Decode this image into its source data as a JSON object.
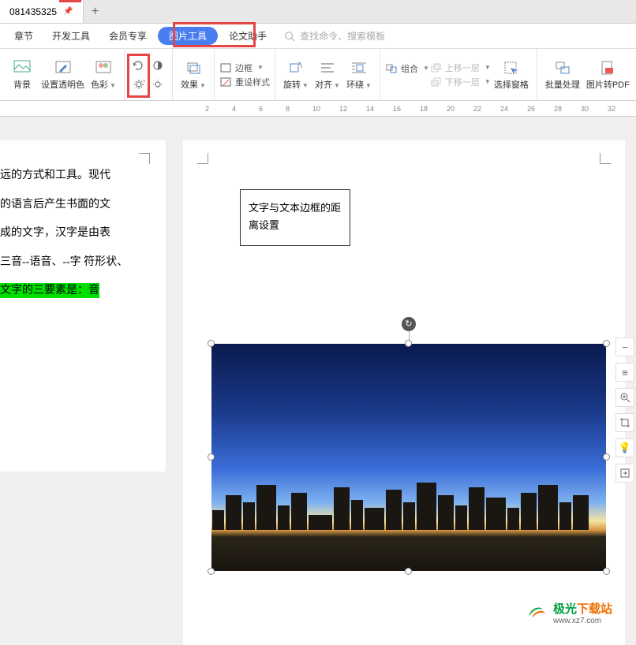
{
  "tab": {
    "title": "081435325",
    "add_tooltip": "+"
  },
  "menu": {
    "items": [
      "章节",
      "开发工具",
      "会员专享",
      "图片工具",
      "论文助手"
    ],
    "active_index": 3,
    "search_placeholder": "查找命令、搜索模板"
  },
  "ribbon": {
    "bg": "背景",
    "trans_color": "设置透明色",
    "color": "色彩",
    "brightness_inc": "增加亮度",
    "brightness_dec": "降低亮度",
    "effects": "效果",
    "border": "边框",
    "reset_style": "重设样式",
    "rotate": "旋转",
    "align": "对齐",
    "wrap": "环绕",
    "group": "组合",
    "layer_up": "上移一层",
    "layer_down": "下移一层",
    "select_pane": "选择窗格",
    "batch": "批量处理",
    "to_pdf": "图片转PDF"
  },
  "ruler": {
    "marks": [
      "2",
      "4",
      "6",
      "8",
      "10",
      "12",
      "14",
      "16",
      "18",
      "20",
      "22",
      "24",
      "26",
      "28",
      "30",
      "32"
    ]
  },
  "page_left": {
    "lines": [
      "远的方式和工具。现代",
      "的语言后产生书面的文",
      "成的文字，汉字是由表",
      "三音--语音、--字 符形状、",
      "文字的三要素是：音"
    ]
  },
  "textbox": {
    "content": "文字与文本边框的距离设置"
  },
  "watermark": {
    "name_cn": "极光下载站",
    "url": "www.xz7.com"
  },
  "side_icons": [
    "minus",
    "lines",
    "zoom",
    "crop",
    "bulb",
    "export"
  ]
}
